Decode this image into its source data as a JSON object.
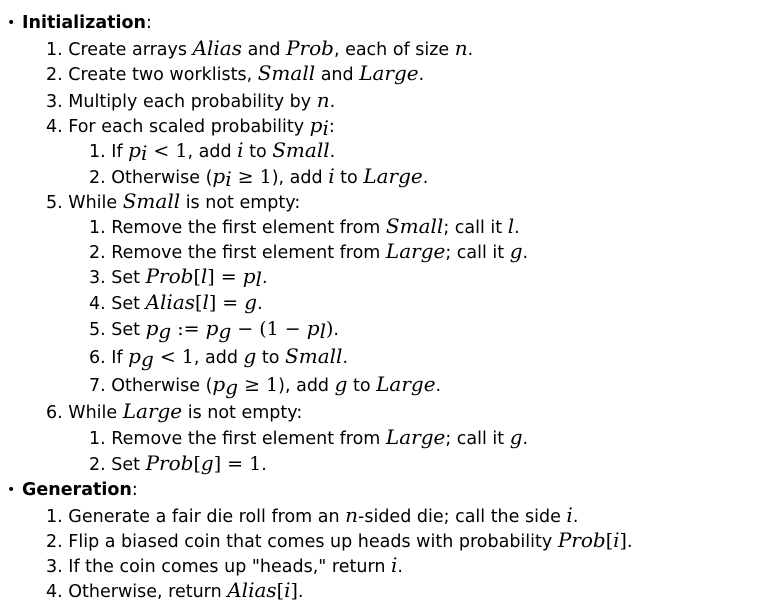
{
  "init": {
    "bullet": "•",
    "heading": "Initialization",
    "colon": ":",
    "steps": [
      {
        "num": "1.",
        "t1": "Create arrays ",
        "m1": "Alias",
        "t2": " and ",
        "m2": "Prob",
        "t3": ", each of size ",
        "m3": "n",
        "t4": "."
      },
      {
        "num": "2.",
        "t1": "Create two worklists, ",
        "m1": "Small",
        "t2": " and ",
        "m2": "Large",
        "t3": "."
      },
      {
        "num": "3.",
        "t1": "Multiply each probability by ",
        "m1": "n",
        "t2": "."
      },
      {
        "num": "4.",
        "t1": "For each scaled probability ",
        "m1": "p",
        "sub": "i",
        "t2": ":"
      },
      {
        "num": "1.",
        "t1": "If ",
        "m1": "p",
        "sub": "i",
        "op": " < 1",
        "t2": ", add ",
        "m2": "i",
        "t3": " to ",
        "m3": "Small",
        "t4": "."
      },
      {
        "num": "2.",
        "t1": "Otherwise (",
        "m1": "p",
        "sub": "i",
        "op": " ≥ 1",
        "t2": "), add ",
        "m2": "i",
        "t3": " to ",
        "m3": "Large",
        "t4": "."
      },
      {
        "num": "5.",
        "t1": "While ",
        "m1": "Small",
        "t2": " is not empty:"
      },
      {
        "num": "1.",
        "t1": "Remove the first element from ",
        "m1": "Small",
        "t2": "; call it ",
        "m2": "l",
        "t3": "."
      },
      {
        "num": "2.",
        "t1": "Remove the first element from ",
        "m1": "Large",
        "t2": "; call it ",
        "m2": "g",
        "t3": "."
      },
      {
        "num": "3.",
        "t1": "Set ",
        "m1": "Prob",
        "b1": "[",
        "m2": "l",
        "b2": "] = ",
        "m3": "p",
        "sub": "l",
        "t2": "."
      },
      {
        "num": "4.",
        "t1": "Set ",
        "m1": "Alias",
        "b1": "[",
        "m2": "l",
        "b2": "] = ",
        "m3": "g",
        "t2": "."
      },
      {
        "num": "5.",
        "t1": "Set ",
        "m1": "p",
        "sub1": "g",
        "op1": " := ",
        "m2": "p",
        "sub2": "g",
        "op2": " − (1 − ",
        "m3": "p",
        "sub3": "l",
        "op3": ")",
        "t2": "."
      },
      {
        "num": "6.",
        "t1": "If ",
        "m1": "p",
        "sub": "g",
        "op": " < 1",
        "t2": ", add ",
        "m2": "g",
        "t3": " to ",
        "m3": "Small",
        "t4": "."
      },
      {
        "num": "7.",
        "t1": "Otherwise (",
        "m1": "p",
        "sub": "g",
        "op": " ≥ 1",
        "t2": "), add ",
        "m2": "g",
        "t3": " to ",
        "m3": "Large",
        "t4": "."
      },
      {
        "num": "6.",
        "t1": "While ",
        "m1": "Large",
        "t2": " is not empty:"
      },
      {
        "num": "1.",
        "t1": "Remove the first element from ",
        "m1": "Large",
        "t2": "; call it ",
        "m2": "g",
        "t3": "."
      },
      {
        "num": "2.",
        "t1": "Set ",
        "m1": "Prob",
        "b1": "[",
        "m2": "g",
        "b2": "] = 1",
        "t2": "."
      }
    ]
  },
  "gen": {
    "bullet": "•",
    "heading": "Generation",
    "colon": ":",
    "steps": [
      {
        "num": "1.",
        "t1": "Generate a fair die roll from an ",
        "m1": "n",
        "t2": "-sided die; call the side ",
        "m2": "i",
        "t3": "."
      },
      {
        "num": "2.",
        "t1": "Flip a biased coin that comes up heads with probability ",
        "m1": "Prob",
        "b1": "[",
        "m2": "i",
        "b2": "]",
        "t2": "."
      },
      {
        "num": "3.",
        "t1": "If the coin comes up \"heads,\" return ",
        "m1": "i",
        "t2": "."
      },
      {
        "num": "4.",
        "t1": "Otherwise, return ",
        "m1": "Alias",
        "b1": "[",
        "m2": "i",
        "b2": "]",
        "t2": "."
      }
    ]
  }
}
